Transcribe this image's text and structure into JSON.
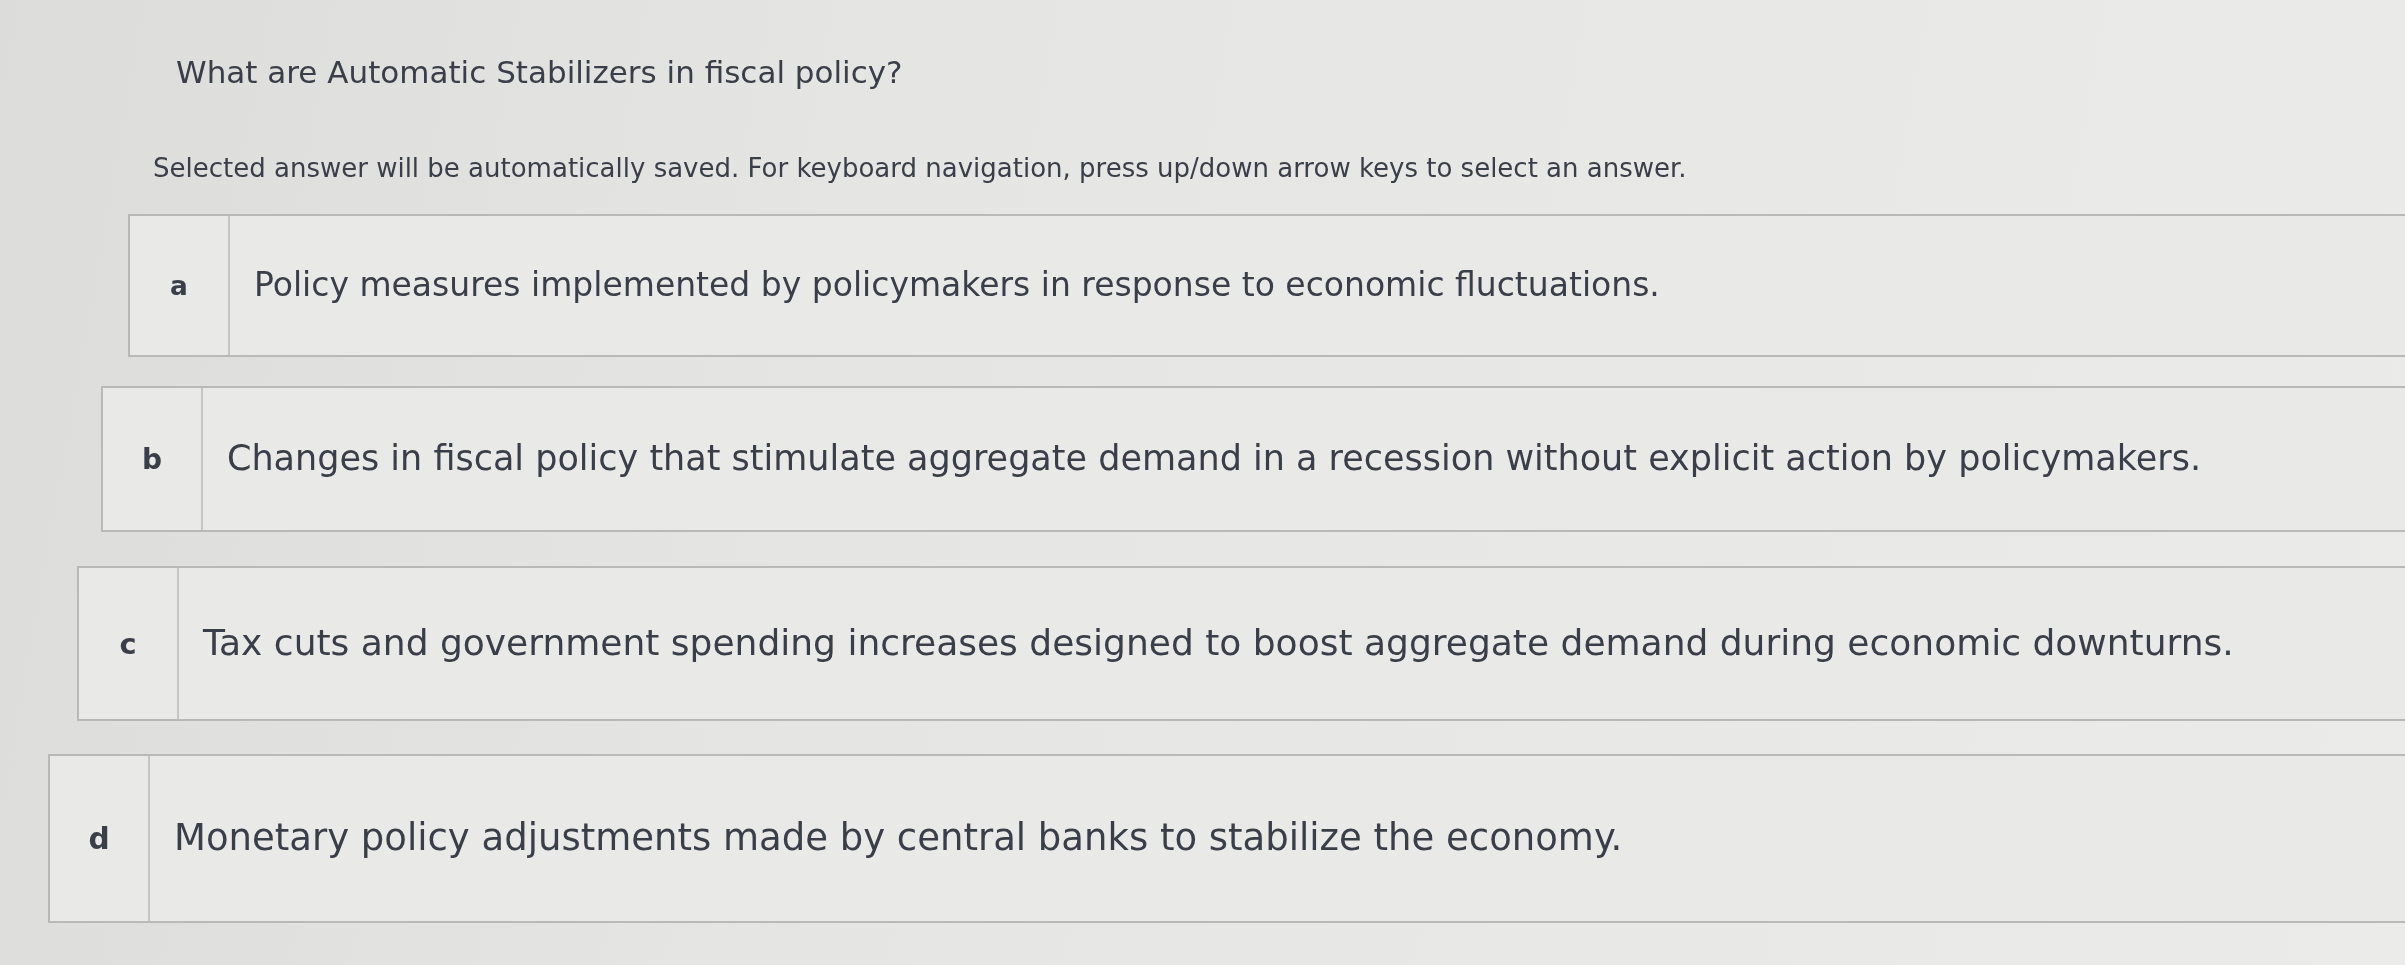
{
  "question": {
    "title": "What are Automatic Stabilizers in fiscal policy?",
    "instructions": "Selected answer will be automatically saved. For keyboard navigation, press up/down arrow keys to select an answer."
  },
  "options": [
    {
      "letter": "a",
      "text": "Policy measures implemented by policymakers in response to economic fluctuations.",
      "selected": false
    },
    {
      "letter": "b",
      "text": "Changes in fiscal policy that stimulate aggregate demand in a recession without explicit action by policymakers.",
      "selected": false
    },
    {
      "letter": "c",
      "text": "Tax cuts and government spending increases designed to boost aggregate demand during economic downturns.",
      "selected": false
    },
    {
      "letter": "d",
      "text": "Monetary policy adjustments made by central banks to stabilize the economy.",
      "selected": false
    }
  ]
}
